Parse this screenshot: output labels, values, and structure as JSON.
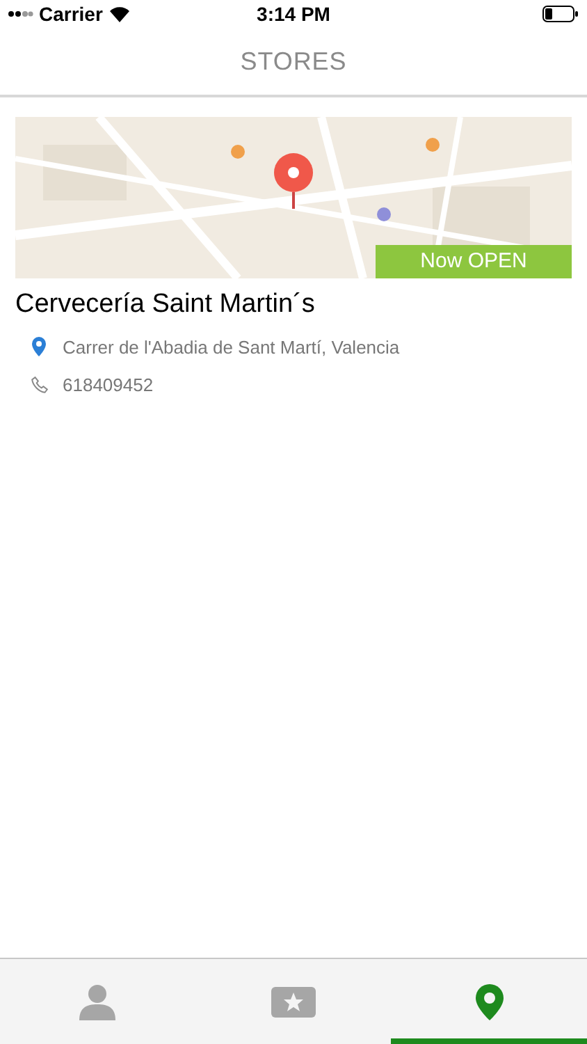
{
  "status_bar": {
    "carrier": "Carrier",
    "time": "3:14 PM"
  },
  "header": {
    "title": "STORES"
  },
  "stores": [
    {
      "name": "Cervecería Saint Martin´s",
      "address": "Carrer de l'Abadia de Sant Martí, Valencia",
      "phone": "618409452",
      "open": true,
      "open_label": "Now OPEN"
    }
  ],
  "tabs": [
    {
      "kind": "profile",
      "selected": false
    },
    {
      "kind": "favorites",
      "selected": false
    },
    {
      "kind": "stores",
      "selected": true
    }
  ]
}
